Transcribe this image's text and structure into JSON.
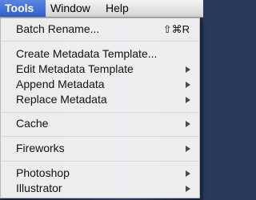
{
  "menubar": {
    "items": [
      {
        "label": "Tools"
      },
      {
        "label": "Window"
      },
      {
        "label": "Help"
      }
    ]
  },
  "tools_menu": {
    "batch_rename": {
      "label": "Batch Rename...",
      "shortcut": "⇧⌘R"
    },
    "create_metadata_template": {
      "label": "Create Metadata Template..."
    },
    "edit_metadata_template": {
      "label": "Edit Metadata Template"
    },
    "append_metadata": {
      "label": "Append Metadata"
    },
    "replace_metadata": {
      "label": "Replace Metadata"
    },
    "cache": {
      "label": "Cache"
    },
    "fireworks": {
      "label": "Fireworks"
    },
    "photoshop": {
      "label": "Photoshop"
    },
    "illustrator": {
      "label": "Illustrator"
    }
  },
  "colors": {
    "menu_highlight": "#2d5fcf",
    "menu_background": "#f5f5f5",
    "submenu_arrow": "#4a4a4a"
  },
  "icons": {
    "submenu": "submenu-arrow-icon"
  }
}
